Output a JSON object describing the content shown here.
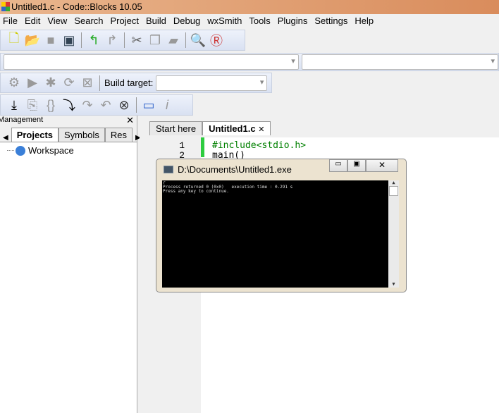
{
  "window": {
    "title": "Untitled1.c - Code::Blocks 10.05"
  },
  "menu": [
    "File",
    "Edit",
    "View",
    "Search",
    "Project",
    "Build",
    "Debug",
    "wxSmith",
    "Tools",
    "Plugins",
    "Settings",
    "Help"
  ],
  "toolbar": {
    "build_target_label": "Build target:",
    "build_target_value": ""
  },
  "management": {
    "title": "Management",
    "tabs": [
      "Projects",
      "Symbols",
      "Res"
    ],
    "tree": [
      "Workspace"
    ]
  },
  "editor": {
    "tabs": [
      "Start here",
      "Untitled1.c"
    ],
    "active_tab": "Untitled1.c",
    "lines": [
      {
        "n": "1",
        "text": "#include<stdio.h>"
      },
      {
        "n": "2",
        "text": "main()"
      }
    ]
  },
  "console": {
    "title": "D:\\Documents\\Untitled1.exe",
    "output": [
      "r",
      "Process returned 0 (0x0)   execution time : 0.291 s",
      "Press any key to continue."
    ]
  }
}
